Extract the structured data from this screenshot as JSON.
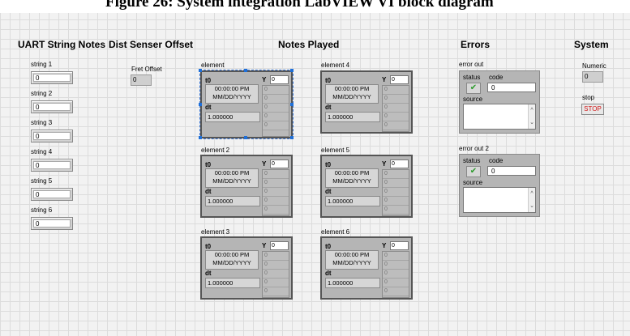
{
  "figure_caption": "Figure 26: System integration LabVIEW VI block diagram",
  "sections": {
    "uart": "UART String Notes",
    "dist": "Dist Senser Offset",
    "notes": "Notes Played",
    "errors": "Errors",
    "system": "System"
  },
  "strings": [
    {
      "label": "string 1",
      "value": "0"
    },
    {
      "label": "string 2",
      "value": "0"
    },
    {
      "label": "string 3",
      "value": "0"
    },
    {
      "label": "string 4",
      "value": "0"
    },
    {
      "label": "string 5",
      "value": "0"
    },
    {
      "label": "string 6",
      "value": "0"
    }
  ],
  "fret_offset": {
    "label": "Fret Offset",
    "value": "0"
  },
  "elements": [
    {
      "label": "element",
      "y_index": "0"
    },
    {
      "label": "element 2",
      "y_index": "0"
    },
    {
      "label": "element 3",
      "y_index": "0"
    },
    {
      "label": "element 4",
      "y_index": "0"
    },
    {
      "label": "element 5",
      "y_index": "0"
    },
    {
      "label": "element 6",
      "y_index": "0"
    }
  ],
  "element_fields": {
    "t0_label": "t0",
    "t0_time": "00:00:00 PM",
    "t0_date": "MM/DD/YYYY",
    "dt_label": "dt",
    "dt_value": "1.000000",
    "y_label": "Y",
    "y_cell": "0"
  },
  "errors": [
    {
      "label": "error out",
      "status_label": "status",
      "code_label": "code",
      "code_value": "0",
      "source_label": "source",
      "status_icon": "check-icon"
    },
    {
      "label": "error out 2",
      "status_label": "status",
      "code_label": "code",
      "code_value": "0",
      "source_label": "source",
      "status_icon": "check-icon"
    }
  ],
  "system": {
    "numeric_label": "Numeric",
    "numeric_value": "0",
    "stop_label": "stop",
    "stop_button": "STOP"
  },
  "colors": {
    "stop_text": "#d01818",
    "status_ok": "#2a9a2a",
    "selection": "#1e6fd9"
  }
}
